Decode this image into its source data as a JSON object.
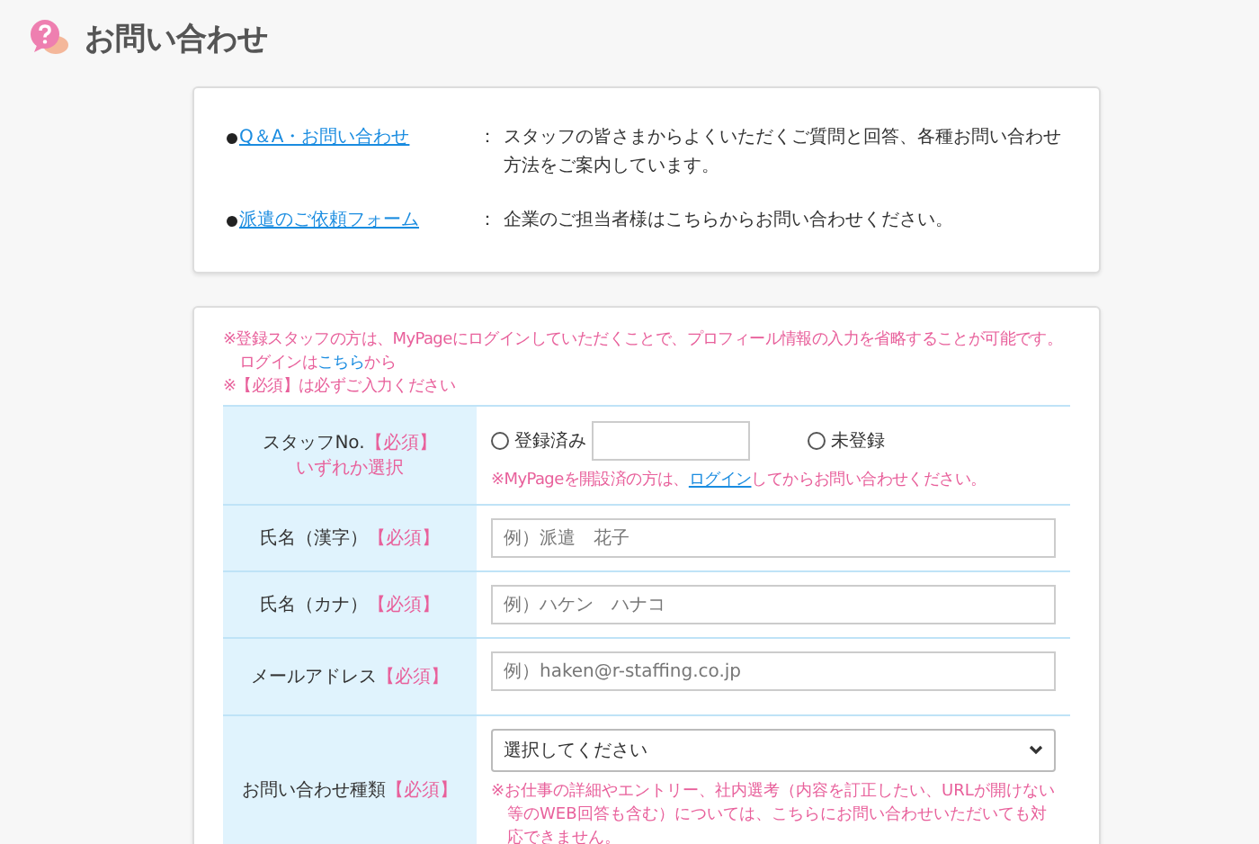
{
  "page_title": "お問い合わせ",
  "links": [
    {
      "label": "Q＆A・お問い合わせ",
      "separator": "：",
      "description": "スタッフの皆さまからよくいただくご質問と回答、各種お問い合わせ方法をご案内しています。"
    },
    {
      "label": "派遣のご依頼フォーム",
      "separator": "：",
      "description": "企業のご担当者様はこちらからお問い合わせください。"
    }
  ],
  "notes": {
    "login_intro": "※登録スタッフの方は、MyPageにログインしていただくことで、プロフィール情報の入力を省略することが可能です。",
    "login_before": "ログインは",
    "login_link": "こちら",
    "login_after": "から",
    "required_note": "※【必須】は必ずご入力ください"
  },
  "form_rows": [
    {
      "kind": "staff",
      "label": "スタッフNo.",
      "required": "【必須】",
      "sublabel": "いずれか選択",
      "options": [
        {
          "label": "登録済み",
          "selected": false
        },
        {
          "label": "未登録",
          "selected": false
        }
      ],
      "note_before": "※MyPageを開設済の方は、",
      "note_link": "ログイン",
      "note_after": "してからお問い合わせください。"
    },
    {
      "kind": "text",
      "label": "氏名（漢字）",
      "required": "【必須】",
      "placeholder": "例）派遣　花子"
    },
    {
      "kind": "text",
      "label": "氏名（カナ）",
      "required": "【必須】",
      "placeholder": "例）ハケン　ハナコ"
    },
    {
      "kind": "text",
      "label": "メールアドレス",
      "required": "【必須】",
      "placeholder": "例）haken@r-staffing.co.jp"
    },
    {
      "kind": "select",
      "label": "お問い合わせ種類",
      "required": "【必須】",
      "value": "選択してください",
      "note": "※お仕事の詳細やエントリー、社内選考（内容を訂正したい、URLが開けない等のWEB回答も含む）については、こちらにお問い合わせいただいても対応できません。"
    }
  ]
}
